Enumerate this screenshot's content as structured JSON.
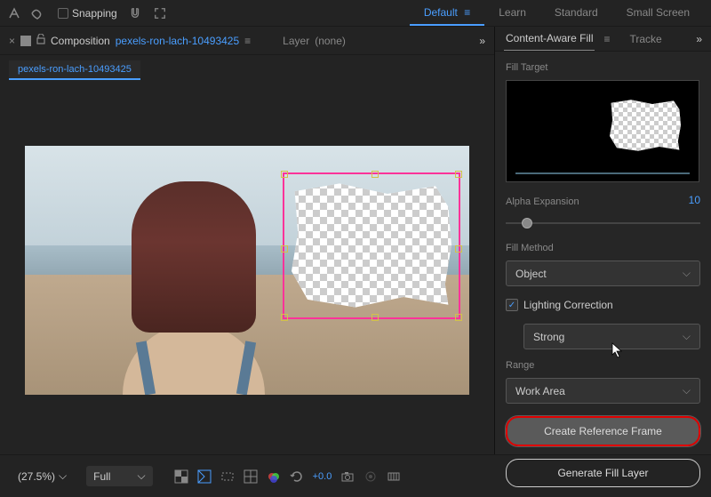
{
  "topbar": {
    "snapping_label": "Snapping",
    "workspaces": {
      "default": "Default",
      "learn": "Learn",
      "standard": "Standard",
      "small_screen": "Small Screen"
    }
  },
  "left_panel": {
    "title": "Composition",
    "comp_name": "pexels-ron-lach-10493425",
    "layer_label": "Layer",
    "layer_value": "(none)",
    "tab_name": "pexels-ron-lach-10493425"
  },
  "right_panel": {
    "tab1": "Content-Aware Fill",
    "tab2": "Tracke",
    "fill_target_label": "Fill Target",
    "alpha_expansion_label": "Alpha Expansion",
    "alpha_expansion_value": "10",
    "fill_method_label": "Fill Method",
    "fill_method_value": "Object",
    "lighting_correction_label": "Lighting Correction",
    "lighting_correction_checked": true,
    "lighting_strength_value": "Strong",
    "range_label": "Range",
    "range_value": "Work Area",
    "create_ref_button": "Create Reference Frame",
    "generate_button": "Generate Fill Layer"
  },
  "bottombar": {
    "zoom": "(27.5%)",
    "resolution": "Full",
    "exposure": "+0.0"
  }
}
